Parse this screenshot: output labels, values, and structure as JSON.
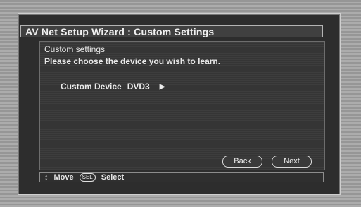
{
  "window": {
    "title": "AV Net Setup Wizard : Custom Settings"
  },
  "content": {
    "heading": "Custom settings",
    "instruction": "Please choose the device you wish to learn.",
    "device_label": "Custom Device",
    "device_value": "DVD3"
  },
  "buttons": {
    "back": "Back",
    "next": "Next"
  },
  "footer": {
    "move_icon": "↕",
    "move_label": "Move",
    "sel_badge": "SEL",
    "select_label": "Select"
  },
  "icons": {
    "move": "updown-arrows-icon",
    "right": "triangle-right-icon"
  }
}
